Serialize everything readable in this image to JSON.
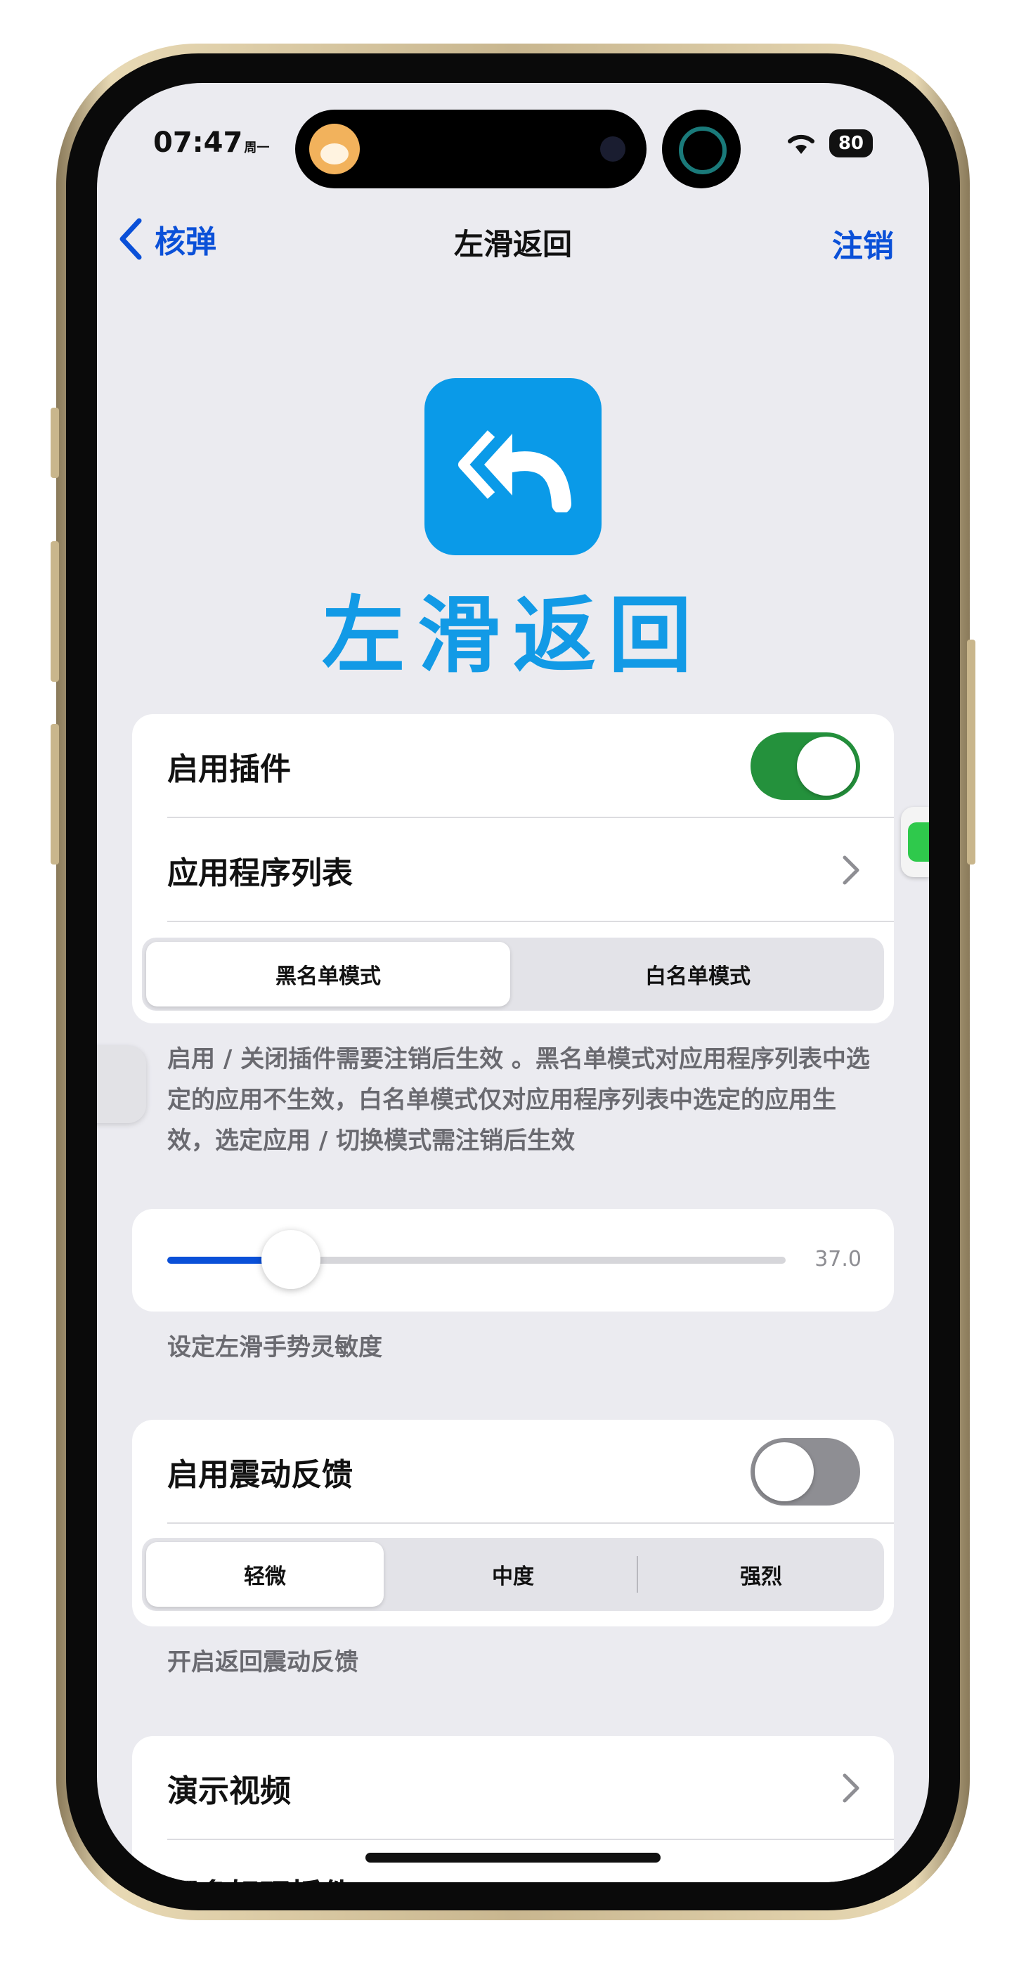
{
  "status_bar": {
    "time": "07:47",
    "weekday": "周一",
    "battery": "80"
  },
  "nav": {
    "back_label": "核弹",
    "title": "左滑返回",
    "right_action": "注销"
  },
  "app": {
    "name": "左滑返回"
  },
  "section1": {
    "enable_plugin_label": "启用插件",
    "enable_plugin_on": true,
    "app_list_label": "应用程序列表",
    "mode_options": [
      "黑名单模式",
      "白名单模式"
    ],
    "mode_selected": "黑名单模式",
    "footnote": "启用 / 关闭插件需要注销后生效 。黑名单模式对应用程序列表中选定的应用不生效，白名单模式仅对应用程序列表中选定的应用生效，选定应用 / 切换模式需注销后生效"
  },
  "section2": {
    "slider_value": 37.0,
    "slider_value_label": "37.0",
    "slider_fill_fraction": 0.2,
    "footnote": "设定左滑手势灵敏度"
  },
  "section3": {
    "haptic_label": "启用震动反馈",
    "haptic_on": false,
    "intensity_options": [
      "轻微",
      "中度",
      "强烈"
    ],
    "intensity_selected": "轻微",
    "footnote": "开启返回震动反馈"
  },
  "section4": {
    "demo_video_label": "演示视频",
    "partial_row_label": "更多好玩插件"
  },
  "colors": {
    "accent": "#0a50d8",
    "toggle_on": "#24913c",
    "logo_blue": "#0a9ae8"
  }
}
